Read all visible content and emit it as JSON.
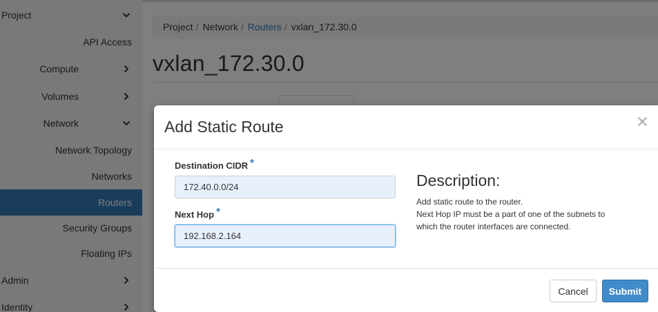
{
  "sidebar": {
    "items": [
      {
        "label": "Project",
        "chevron": "down"
      },
      {
        "label": "API Access",
        "chevron": ""
      },
      {
        "label": "Compute",
        "chevron": "right"
      },
      {
        "label": "Volumes",
        "chevron": "right"
      },
      {
        "label": "Network",
        "chevron": "down"
      },
      {
        "label": "Network Topology",
        "chevron": ""
      },
      {
        "label": "Networks",
        "chevron": ""
      },
      {
        "label": "Routers",
        "chevron": "",
        "active": true
      },
      {
        "label": "Security Groups",
        "chevron": ""
      },
      {
        "label": "Floating IPs",
        "chevron": ""
      },
      {
        "label": "Admin",
        "chevron": "right"
      },
      {
        "label": "Identity",
        "chevron": "right"
      }
    ]
  },
  "breadcrumb": {
    "items": [
      "Project",
      "Network",
      "Routers",
      "vxlan_172.30.0"
    ],
    "separator": "/"
  },
  "page": {
    "title": "vxlan_172.30.0"
  },
  "modal": {
    "title": "Add Static Route",
    "fields": {
      "destination": {
        "label": "Destination CIDR",
        "required_mark": "*",
        "value": "172.40.0.0/24"
      },
      "next_hop": {
        "label": "Next Hop",
        "required_mark": "*",
        "value": "192.168.2.164"
      }
    },
    "description": {
      "title": "Description:",
      "lines": [
        "Add static route to the router.",
        "Next Hop IP must be a part of one of the subnets to",
        "which the router interfaces are connected."
      ]
    },
    "buttons": {
      "cancel": "Cancel",
      "submit": "Submit"
    }
  },
  "colors": {
    "accent": "#337ab7",
    "submit": "#428bca",
    "input_bg": "#e8f0fe",
    "focus_border": "#66afe9"
  },
  "icons": {
    "close": "close-icon",
    "chevron_down": "chevron-down-icon",
    "chevron_right": "chevron-right-icon"
  }
}
